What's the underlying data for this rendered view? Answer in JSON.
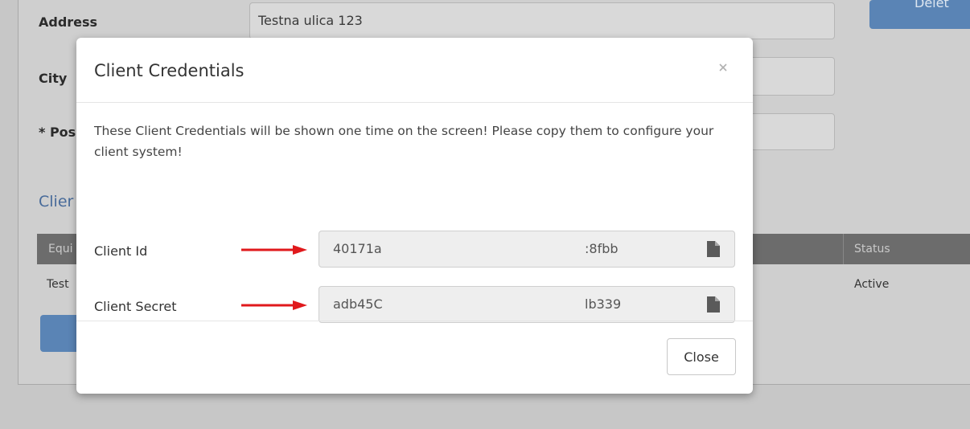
{
  "background": {
    "fields": [
      {
        "label": "Address",
        "value": "Testna ulica 123"
      },
      {
        "label": "City",
        "value": ""
      },
      {
        "label": "* Pos",
        "value": ""
      }
    ],
    "top_button_label": "Delet",
    "section_title": "Clier",
    "table": {
      "headers": [
        "Equi",
        "Status"
      ],
      "row": [
        "Test",
        "Active"
      ]
    }
  },
  "modal": {
    "title": "Client Credentials",
    "close_symbol": "×",
    "notice": "These Client Credentials will be shown one time on the screen! Please copy them to configure your client system!",
    "credentials": [
      {
        "label": "Client Id",
        "value_start": "40171a",
        "value_end": ":8fbb"
      },
      {
        "label": "Client Secret",
        "value_start": "adb45C",
        "value_end": "lb339"
      }
    ],
    "close_button_label": "Close"
  },
  "colors": {
    "arrow": "#e0191c",
    "overlay": "#c7c7c7",
    "primary_button": "#5a84b5"
  },
  "icons": {
    "copy": "file-copy-icon",
    "close": "close-icon",
    "arrow": "arrow-right-icon"
  }
}
